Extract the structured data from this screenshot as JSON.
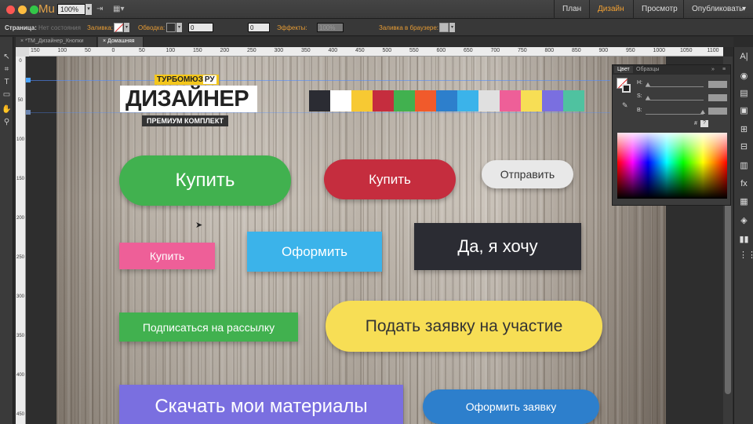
{
  "titlebar": {
    "app_logo": "Mu",
    "zoom": "100%",
    "nav": [
      "План",
      "Дизайн",
      "Просмотр",
      "Опубликовать"
    ],
    "publish_arrow": "▾"
  },
  "controlbar": {
    "page_label": "Страница:",
    "page_value": "Нет состояния",
    "fill_label": "Заливка:",
    "stroke_label": "Обводка:",
    "stroke_value": "0",
    "corner_value": "0",
    "effects_label": "Эффекты:",
    "opacity_value": "100%",
    "browser_fill_label": "Заливка в браузере:"
  },
  "tabs": [
    "*ТМ_Дизайнер_Кнопки",
    "Домашняя"
  ],
  "ruler_top": [
    "150",
    "100",
    "50",
    "0",
    "50",
    "100",
    "150",
    "200",
    "250",
    "300",
    "350",
    "400",
    "450",
    "500",
    "550",
    "600",
    "650",
    "700",
    "750",
    "800",
    "850",
    "900",
    "950",
    "1000",
    "1050",
    "1100"
  ],
  "ruler_left": [
    "0",
    "50",
    "100",
    "150",
    "200",
    "250",
    "300",
    "350",
    "400",
    "450"
  ],
  "logo": {
    "top": "ТУРБОМЮЗ",
    "top_suffix": "РУ",
    "main": "ДИЗАЙНЕР",
    "sub": "ПРЕМИУМ КОМПЛЕКТ"
  },
  "palette": [
    "#2b2c33",
    "#ffffff",
    "#f7c933",
    "#c52d3e",
    "#41b14f",
    "#f15a2b",
    "#2d7fcc",
    "#3bb3ea",
    "#e0e0e0",
    "#ee5f98",
    "#f7de55",
    "#7a6fe0",
    "#4fc2a0"
  ],
  "buttons": {
    "buy_green": "Купить",
    "buy_red": "Купить",
    "send": "Отправить",
    "buy_pink": "Купить",
    "checkout": "Оформить",
    "yes": "Да, я хочу",
    "subscribe": "Подписаться на рассылку",
    "apply": "Подать заявку на участие",
    "download": "Скачать мои материалы",
    "order": "Оформить заявку"
  },
  "color_panel": {
    "tabs": [
      "Цвет",
      "Образцы"
    ],
    "h_label": "H:",
    "s_label": "S:",
    "b_label": "B:",
    "hash": "#",
    "hex_value": "?"
  }
}
